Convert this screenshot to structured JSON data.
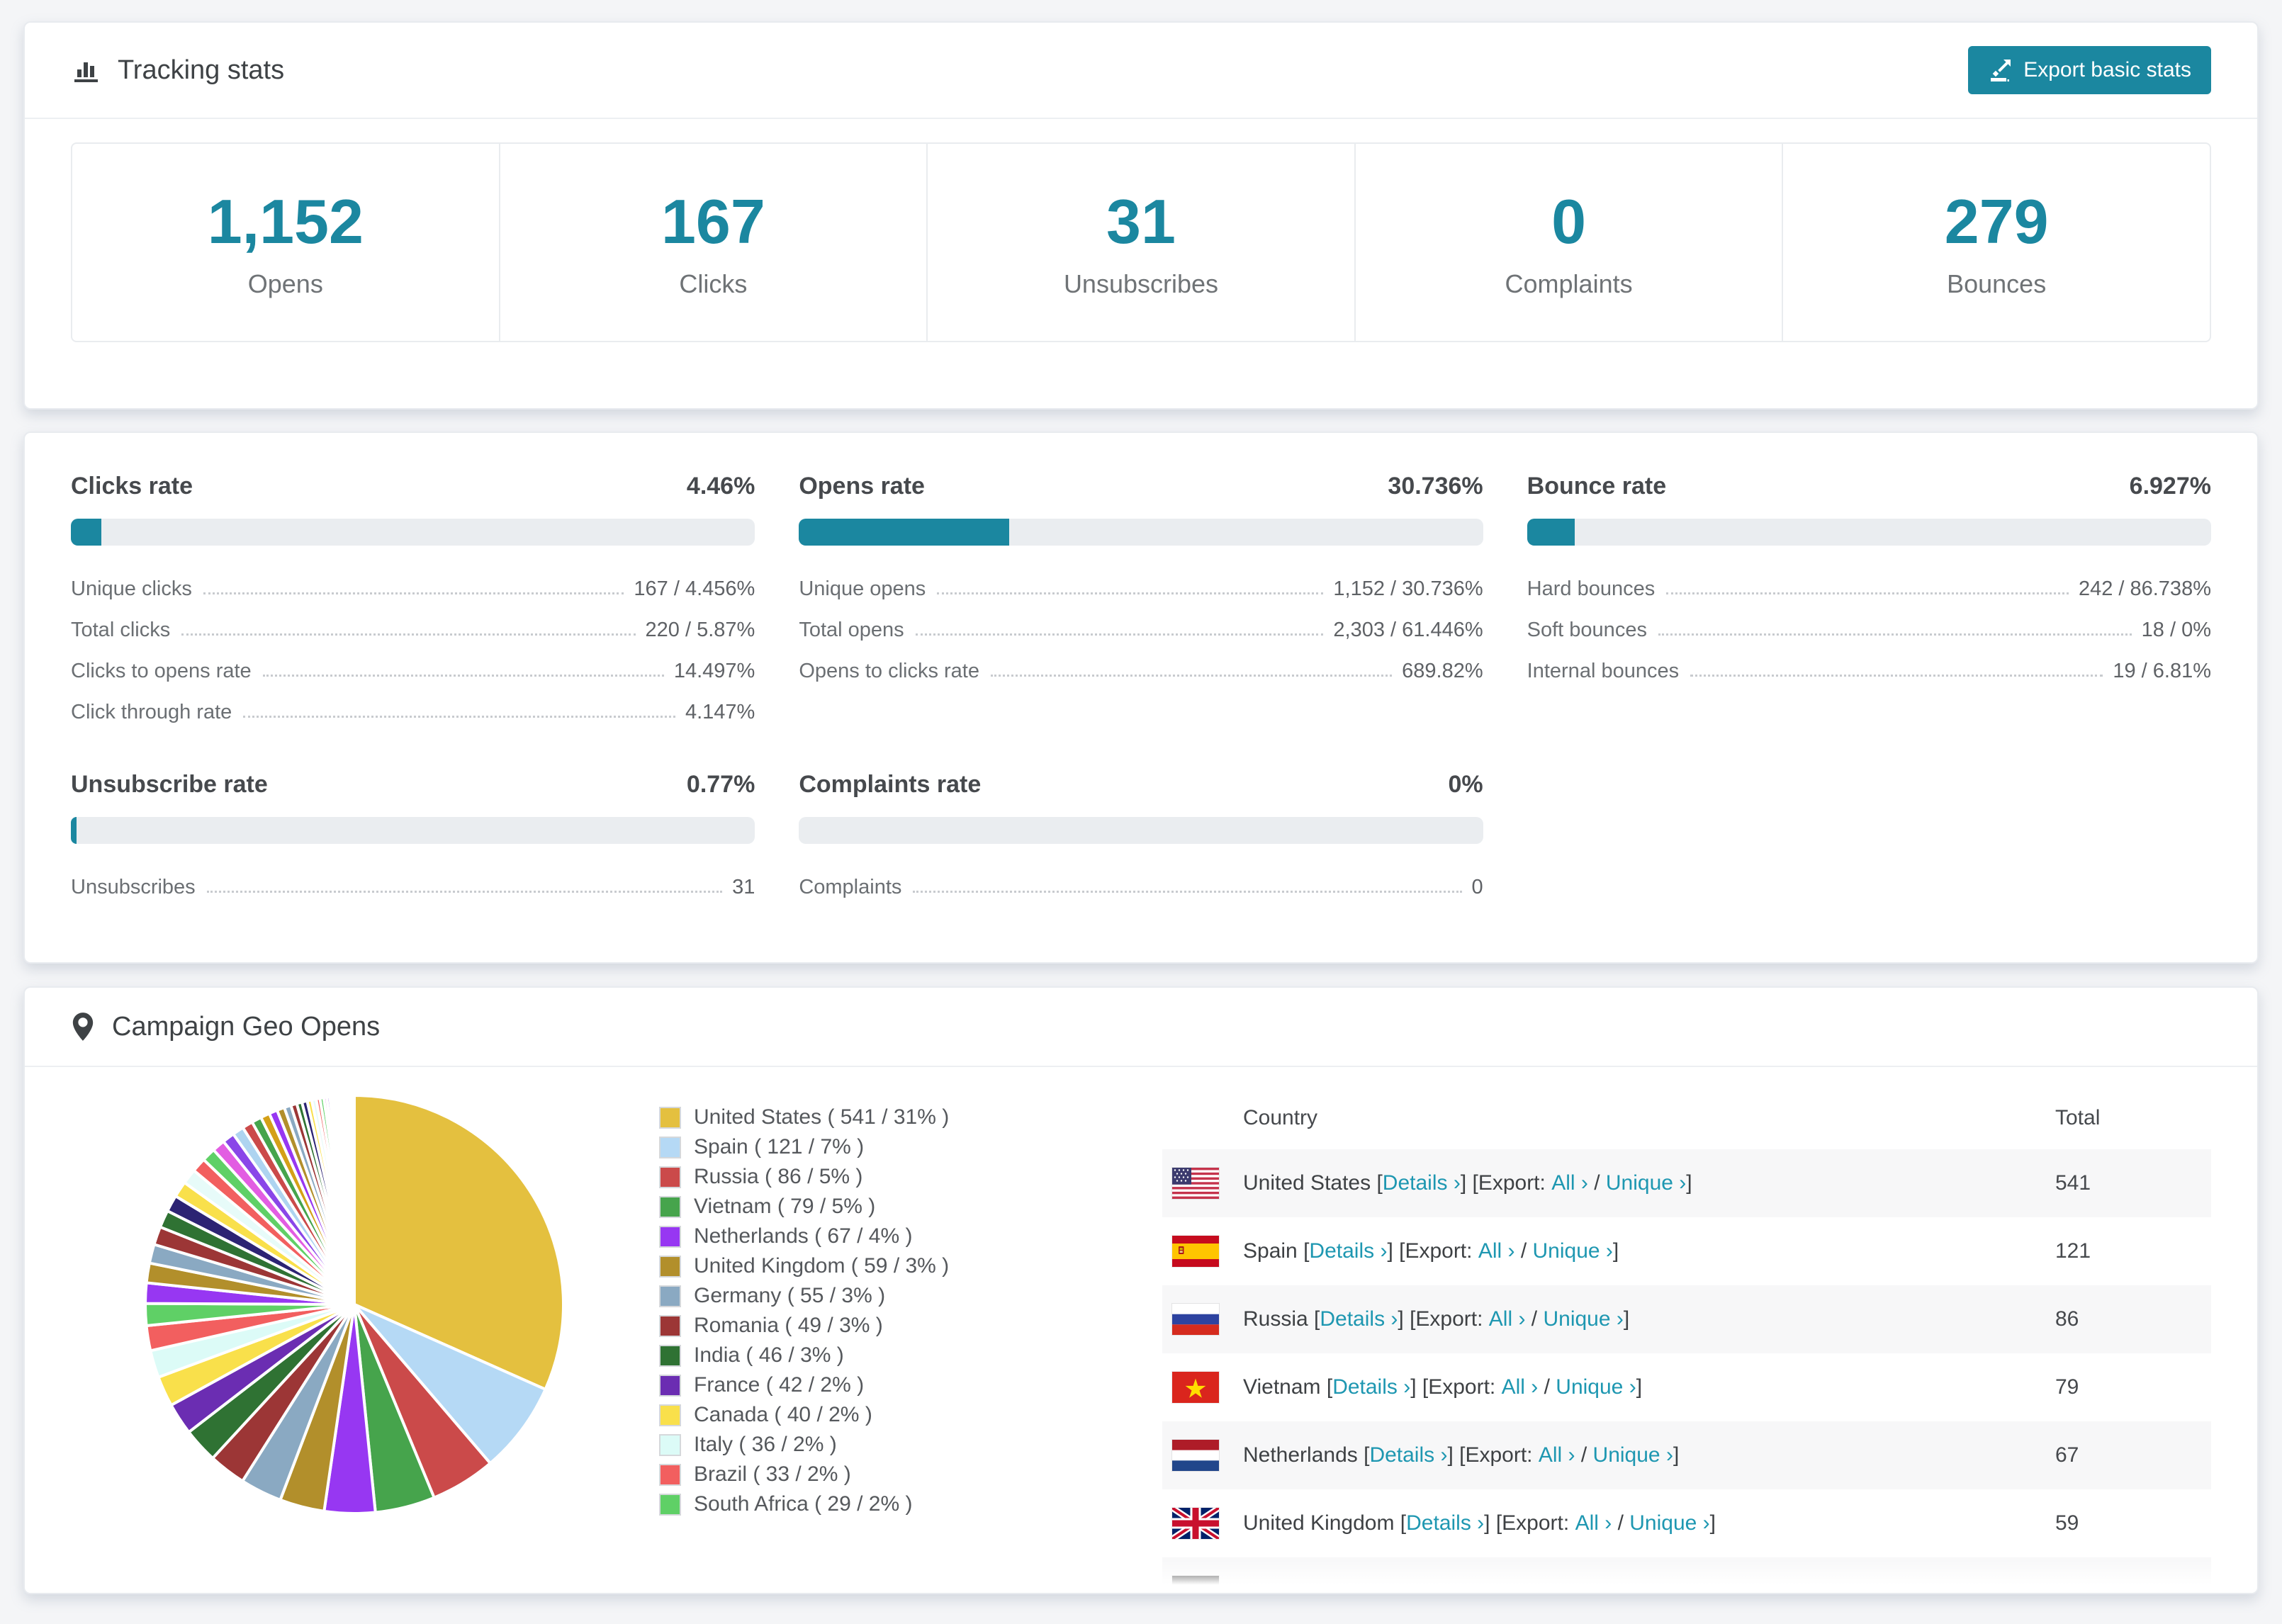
{
  "colors": {
    "accent": "#1b87a0",
    "link": "#1e97b1",
    "bar_track": "#eaedf0",
    "row_alt": "#f7f7f8"
  },
  "tracking": {
    "title": "Tracking stats",
    "export_label": "Export basic stats",
    "stats": [
      {
        "value": "1,152",
        "label": "Opens"
      },
      {
        "value": "167",
        "label": "Clicks"
      },
      {
        "value": "31",
        "label": "Unsubscribes"
      },
      {
        "value": "0",
        "label": "Complaints"
      },
      {
        "value": "279",
        "label": "Bounces"
      }
    ]
  },
  "rates": [
    {
      "title": "Clicks rate",
      "value": "4.46%",
      "percent": 4.46,
      "rows": [
        {
          "label": "Unique clicks",
          "value": "167 / 4.456%"
        },
        {
          "label": "Total clicks",
          "value": "220 / 5.87%"
        },
        {
          "label": "Clicks to opens rate",
          "value": "14.497%"
        },
        {
          "label": "Click through rate",
          "value": "4.147%"
        }
      ]
    },
    {
      "title": "Opens rate",
      "value": "30.736%",
      "percent": 30.736,
      "rows": [
        {
          "label": "Unique opens",
          "value": "1,152 / 30.736%"
        },
        {
          "label": "Total opens",
          "value": "2,303 / 61.446%"
        },
        {
          "label": "Opens to clicks rate",
          "value": "689.82%"
        }
      ]
    },
    {
      "title": "Bounce rate",
      "value": "6.927%",
      "percent": 6.927,
      "rows": [
        {
          "label": "Hard bounces",
          "value": "242 / 86.738%"
        },
        {
          "label": "Soft bounces",
          "value": "18 / 0%"
        },
        {
          "label": "Internal bounces",
          "value": "19 / 6.81%"
        }
      ]
    },
    {
      "title": "Unsubscribe rate",
      "value": "0.77%",
      "percent": 0.77,
      "rows": [
        {
          "label": "Unsubscribes",
          "value": "31"
        }
      ]
    },
    {
      "title": "Complaints rate",
      "value": "0%",
      "percent": 0,
      "rows": [
        {
          "label": "Complaints",
          "value": "0"
        }
      ]
    }
  ],
  "geo": {
    "title": "Campaign Geo Opens",
    "chart_data": {
      "type": "pie",
      "title": "Campaign Geo Opens",
      "legend_position": "right",
      "start_angle_deg": -90,
      "direction": "clockwise",
      "series": [
        {
          "name": "United States",
          "value": 541,
          "pct": "31%",
          "color": "#e4c03f"
        },
        {
          "name": "Spain",
          "value": 121,
          "pct": "7%",
          "color": "#b5d9f5"
        },
        {
          "name": "Russia",
          "value": 86,
          "pct": "5%",
          "color": "#cb4a4a"
        },
        {
          "name": "Vietnam",
          "value": 79,
          "pct": "5%",
          "color": "#46a44c"
        },
        {
          "name": "Netherlands",
          "value": 67,
          "pct": "4%",
          "color": "#9737f2"
        },
        {
          "name": "United Kingdom",
          "value": 59,
          "pct": "3%",
          "color": "#b28f2b"
        },
        {
          "name": "Germany",
          "value": 55,
          "pct": "3%",
          "color": "#8aa9c2"
        },
        {
          "name": "Romania",
          "value": 49,
          "pct": "3%",
          "color": "#9c3636"
        },
        {
          "name": "India",
          "value": 46,
          "pct": "3%",
          "color": "#2f7233"
        },
        {
          "name": "France",
          "value": 42,
          "pct": "2%",
          "color": "#6b2db2"
        },
        {
          "name": "Canada",
          "value": 40,
          "pct": "2%",
          "color": "#f9e04b"
        },
        {
          "name": "Italy",
          "value": 36,
          "pct": "2%",
          "color": "#dcfbf7"
        },
        {
          "name": "Brazil",
          "value": 33,
          "pct": "2%",
          "color": "#f25f5f"
        },
        {
          "name": "South Africa",
          "value": 29,
          "pct": "2%",
          "color": "#5fd066"
        }
      ],
      "others_unlabeled_tail": {
        "values": [
          27,
          26,
          25,
          24,
          23,
          22,
          21,
          20,
          19,
          18,
          17,
          16,
          15,
          14,
          13,
          12,
          11,
          10,
          9,
          8,
          7,
          7,
          6,
          6,
          5,
          5,
          4,
          4,
          3,
          3,
          3,
          2,
          2,
          2,
          2,
          2,
          2,
          1,
          1,
          1,
          1,
          1,
          1,
          1,
          1,
          1,
          1,
          1
        ],
        "colors": [
          "#9737f2",
          "#b28f2b",
          "#8aa9c2",
          "#9c3636",
          "#2f7233",
          "#2c2373",
          "#f9e04b",
          "#e7fbf9",
          "#f25f5f",
          "#5fd066",
          "#e25de2",
          "#8a46e8",
          "#aed4f0",
          "#cb4a4a",
          "#46a44c",
          "#d4a017"
        ]
      }
    },
    "legend_format": {
      "open": " ( ",
      "sep": " / ",
      "close": " )"
    },
    "table": {
      "headers": [
        "Country",
        "Total"
      ],
      "link_labels": {
        "details": "Details ›",
        "export_prefix": "Export: ",
        "all": "All ›",
        "unique": "Unique ›"
      },
      "rows": [
        {
          "country": "United States",
          "flag": "us",
          "total": "541"
        },
        {
          "country": "Spain",
          "flag": "es",
          "total": "121"
        },
        {
          "country": "Russia",
          "flag": "ru",
          "total": "86"
        },
        {
          "country": "Vietnam",
          "flag": "vn",
          "total": "79"
        },
        {
          "country": "Netherlands",
          "flag": "nl",
          "total": "67"
        },
        {
          "country": "United Kingdom",
          "flag": "gb",
          "total": "59"
        }
      ],
      "partial_row": {
        "flag": "de"
      }
    }
  }
}
